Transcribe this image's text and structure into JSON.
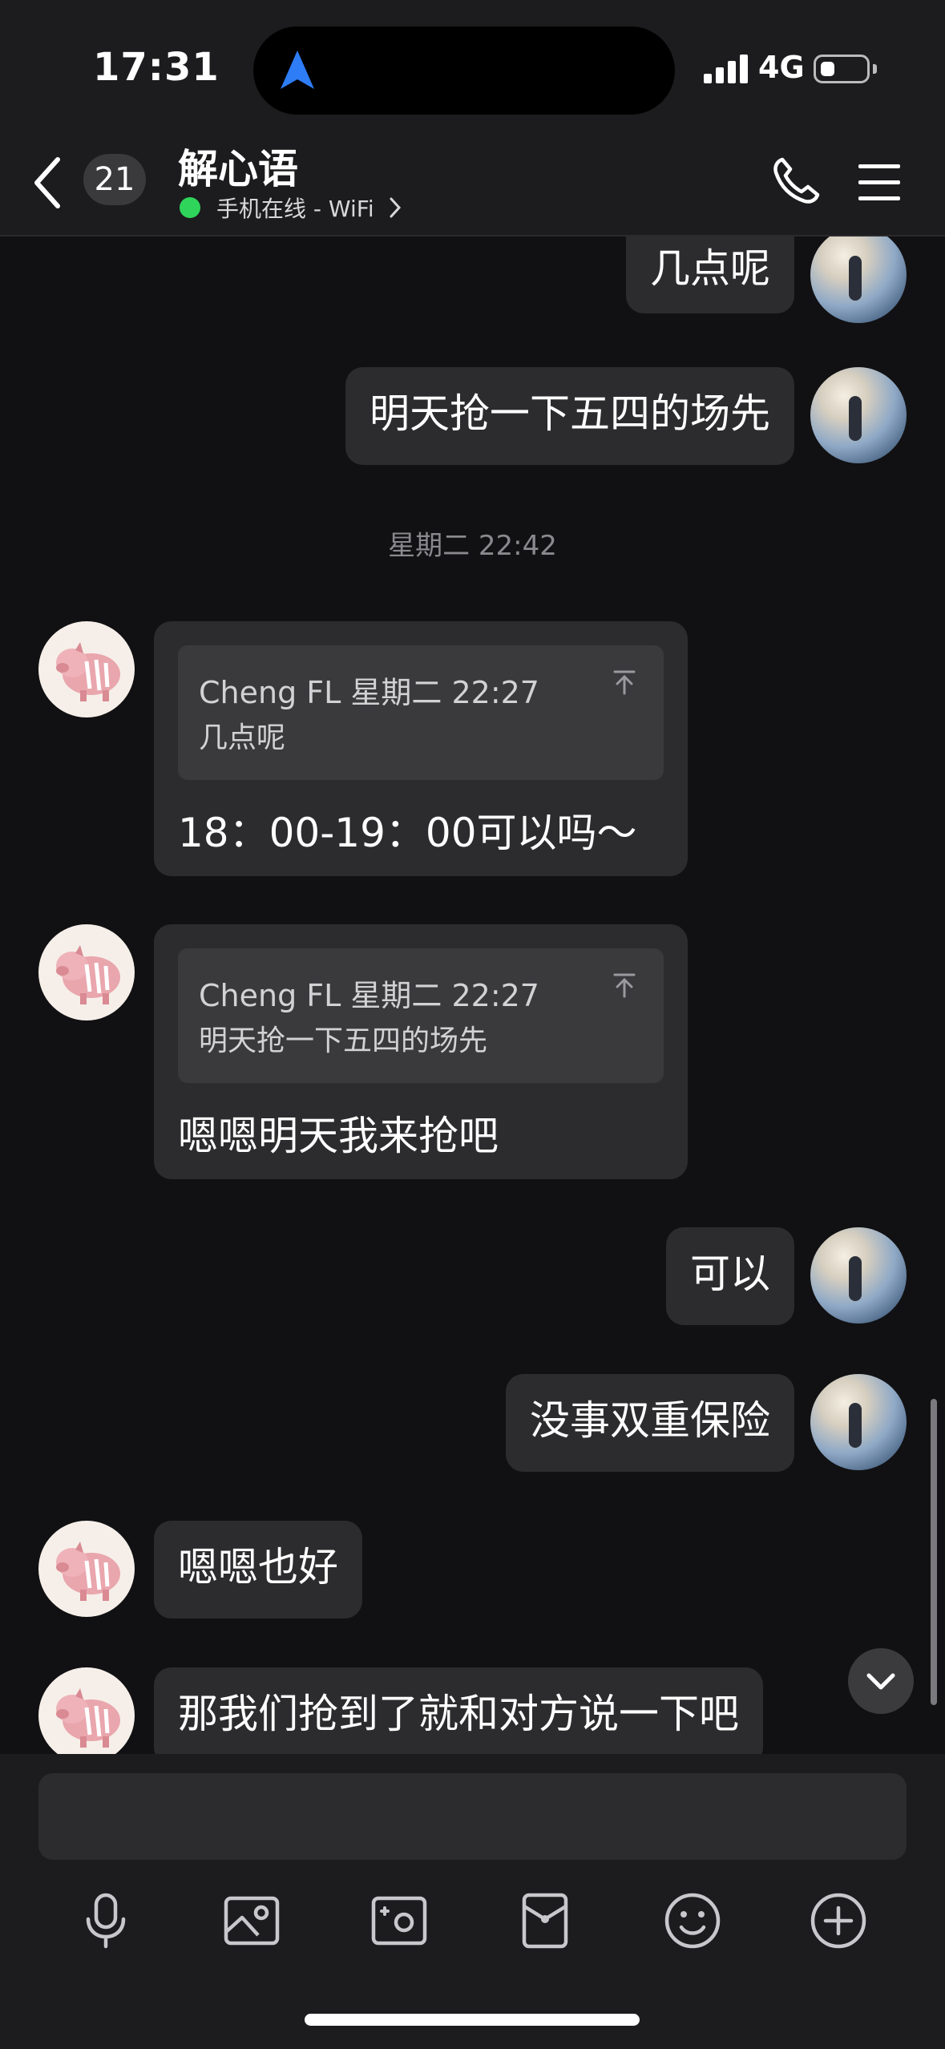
{
  "status": {
    "time": "17:31",
    "network": "4G"
  },
  "header": {
    "unread_count": "21",
    "title": "解心语",
    "online_status": "手机在线 - WiFi"
  },
  "messages": [
    {
      "side": "me",
      "text": "几点呢"
    },
    {
      "side": "me",
      "text": "明天抢一下五四的场先"
    },
    {
      "timestamp": "星期二 22:42"
    },
    {
      "side": "them",
      "quote_meta": "Cheng FL 星期二 22:27",
      "quote_text": "几点呢",
      "text": "18：00-19：00可以吗～"
    },
    {
      "side": "them",
      "quote_meta": "Cheng FL 星期二 22:27",
      "quote_text": "明天抢一下五四的场先",
      "text": "嗯嗯明天我来抢吧"
    },
    {
      "side": "me",
      "text": "可以"
    },
    {
      "side": "me",
      "text": "没事双重保险"
    },
    {
      "side": "them",
      "text": "嗯嗯也好"
    },
    {
      "side": "them",
      "text": "那我们抢到了就和对方说一下吧"
    }
  ],
  "toolbar": [
    "mic-icon",
    "image-icon",
    "camera-icon",
    "red-packet-icon",
    "emoji-icon",
    "plus-icon"
  ]
}
